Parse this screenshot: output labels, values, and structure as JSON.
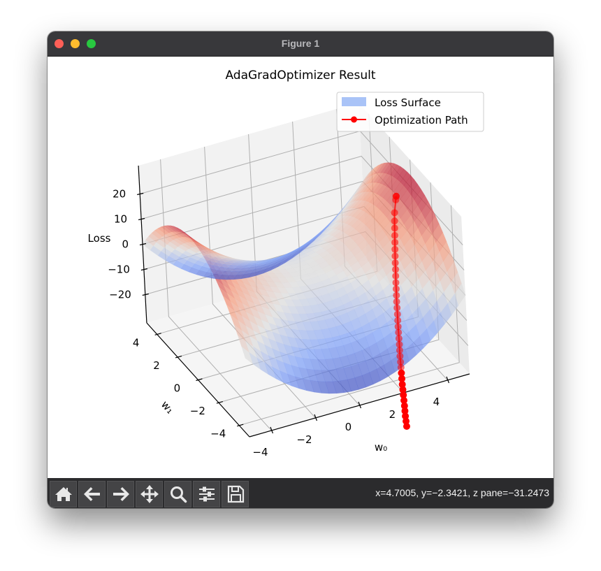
{
  "window": {
    "title": "Figure 1",
    "traffic_lights": [
      "close",
      "minimize",
      "zoom"
    ]
  },
  "toolbar": {
    "buttons": [
      {
        "name": "home",
        "icon": "home-icon"
      },
      {
        "name": "back",
        "icon": "arrow-left-icon"
      },
      {
        "name": "forward",
        "icon": "arrow-right-icon"
      },
      {
        "name": "pan",
        "icon": "move-icon"
      },
      {
        "name": "zoom",
        "icon": "magnifier-icon"
      },
      {
        "name": "configure-subplots",
        "icon": "sliders-icon"
      },
      {
        "name": "save",
        "icon": "floppy-disk-icon"
      }
    ],
    "status": "x=4.7005, y=−2.3421, z pane=−31.2473"
  },
  "chart_data": {
    "type": "surface3d",
    "title": "AdaGradOptimizer Result",
    "xlabel": "w₀",
    "ylabel": "w₁",
    "zlabel": "Loss",
    "xlim": [
      -5,
      5
    ],
    "ylim": [
      -5,
      5
    ],
    "zlim": [
      -31.25,
      31.25
    ],
    "xticks": [
      -4,
      -2,
      0,
      2,
      4
    ],
    "yticks": [
      -4,
      -2,
      0,
      2,
      4
    ],
    "zticks": [
      -20,
      -10,
      0,
      10,
      20
    ],
    "tick_labels": {
      "x": [
        "−4",
        "−2",
        "0",
        "2",
        "4"
      ],
      "y": [
        "−4",
        "−2",
        "0",
        "2",
        "4"
      ],
      "z": [
        "−20",
        "−10",
        "0",
        "10",
        "20"
      ]
    },
    "grid": true,
    "legend": {
      "placement": "top-right",
      "entries": [
        {
          "label": "Loss Surface",
          "color": "#a9c3f7",
          "kind": "patch"
        },
        {
          "label": "Optimization Path",
          "color": "#ff0000",
          "kind": "line-marker"
        }
      ]
    },
    "surface": {
      "function": "w0^2 - w1^2",
      "colormap": "coolwarm",
      "alpha": 0.7,
      "range": [
        -5,
        5
      ]
    },
    "path": {
      "color": "#ff0000",
      "points": [
        [
          4.3,
          0.0
        ],
        [
          4.22,
          -0.12
        ],
        [
          3.95,
          -0.55
        ],
        [
          3.8,
          -0.85
        ],
        [
          3.68,
          -1.1
        ],
        [
          3.56,
          -1.35
        ],
        [
          3.45,
          -1.58
        ],
        [
          3.34,
          -1.8
        ],
        [
          3.24,
          -2.01
        ],
        [
          3.14,
          -2.22
        ],
        [
          3.05,
          -2.42
        ],
        [
          2.96,
          -2.61
        ],
        [
          2.87,
          -2.8
        ],
        [
          2.79,
          -2.98
        ],
        [
          2.71,
          -3.16
        ],
        [
          2.63,
          -3.33
        ],
        [
          2.56,
          -3.5
        ],
        [
          2.49,
          -3.67
        ],
        [
          2.42,
          -3.83
        ],
        [
          2.35,
          -3.99
        ],
        [
          2.29,
          -4.14
        ],
        [
          2.23,
          -4.29
        ],
        [
          2.17,
          -4.44
        ],
        [
          2.11,
          -4.58
        ],
        [
          2.05,
          -4.72
        ],
        [
          2.0,
          -4.86
        ],
        [
          1.95,
          -4.99
        ],
        [
          1.9,
          -5.12
        ],
        [
          1.85,
          -5.25
        ],
        [
          1.8,
          -5.38
        ],
        [
          1.76,
          -5.5
        ],
        [
          1.72,
          -5.62
        ],
        [
          1.68,
          -5.74
        ],
        [
          1.64,
          -5.86
        ],
        [
          1.6,
          -5.97
        ],
        [
          1.56,
          -6.08
        ],
        [
          1.53,
          -6.19
        ],
        [
          1.5,
          -6.3
        ]
      ]
    }
  }
}
